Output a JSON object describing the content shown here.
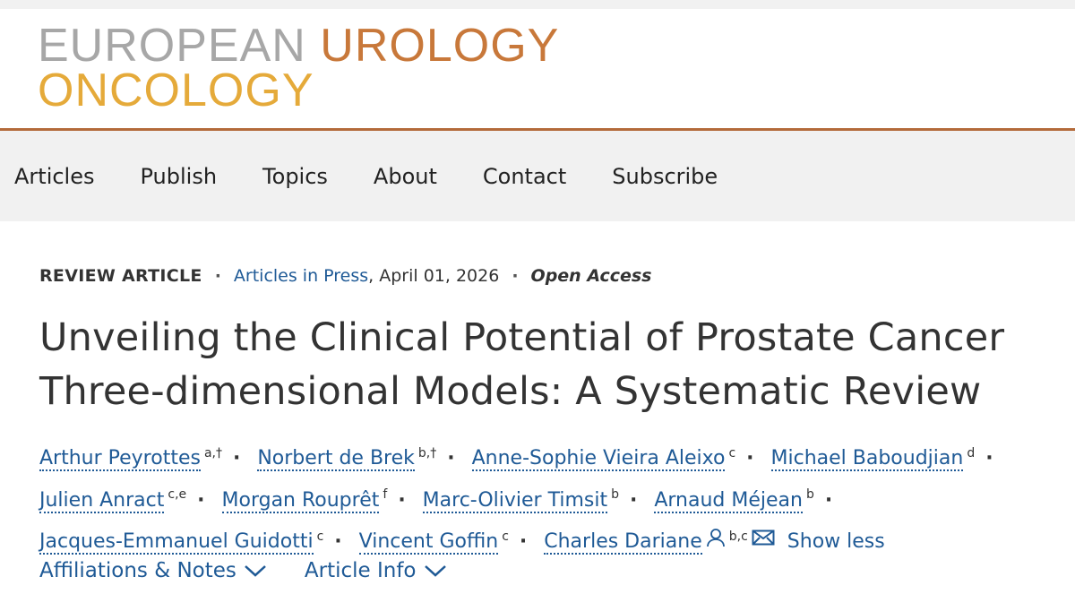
{
  "logo": {
    "word_european": "EUROPEAN",
    "word_urology": "UROLOGY",
    "word_oncology": "ONCOLOGY"
  },
  "nav": {
    "items": [
      "Articles",
      "Publish",
      "Topics",
      "About",
      "Contact",
      "Subscribe"
    ]
  },
  "meta": {
    "type": "REVIEW ARTICLE",
    "section": "Articles in Press",
    "date": ", April 01, 2026",
    "access": "Open Access"
  },
  "title": "Unveiling the Clinical Potential of Prostate Cancer Three-dimensional Models: A Systematic Review",
  "authors": [
    {
      "name": "Arthur Peyrottes",
      "sup": "a,†"
    },
    {
      "name": "Norbert de Brek",
      "sup": "b,†"
    },
    {
      "name": "Anne-Sophie Vieira Aleixo",
      "sup": "c"
    },
    {
      "name": "Michael Baboudjian",
      "sup": "d"
    },
    {
      "name": "Julien Anract",
      "sup": "c,e"
    },
    {
      "name": "Morgan Rouprêt",
      "sup": "f"
    },
    {
      "name": "Marc-Olivier Timsit",
      "sup": "b"
    },
    {
      "name": "Arnaud Méjean",
      "sup": "b"
    },
    {
      "name": "Jacques-Emmanuel Guidotti",
      "sup": "c"
    },
    {
      "name": "Vincent Goffin",
      "sup": "c"
    },
    {
      "name": "Charles Dariane",
      "sup": "b,c"
    }
  ],
  "show_less": "Show less",
  "bottom_links": {
    "affiliations": "Affiliations & Notes",
    "article_info": "Article Info"
  },
  "icons": {
    "corresponding": "person-icon",
    "email": "mail-icon",
    "expand": "chevron-down-icon"
  },
  "colors": {
    "link": "#1f5a96",
    "logo_gray": "#a7a7a7",
    "logo_orange": "#c8783a",
    "logo_gold": "#e5aa3a",
    "rule": "#b36a3a"
  }
}
